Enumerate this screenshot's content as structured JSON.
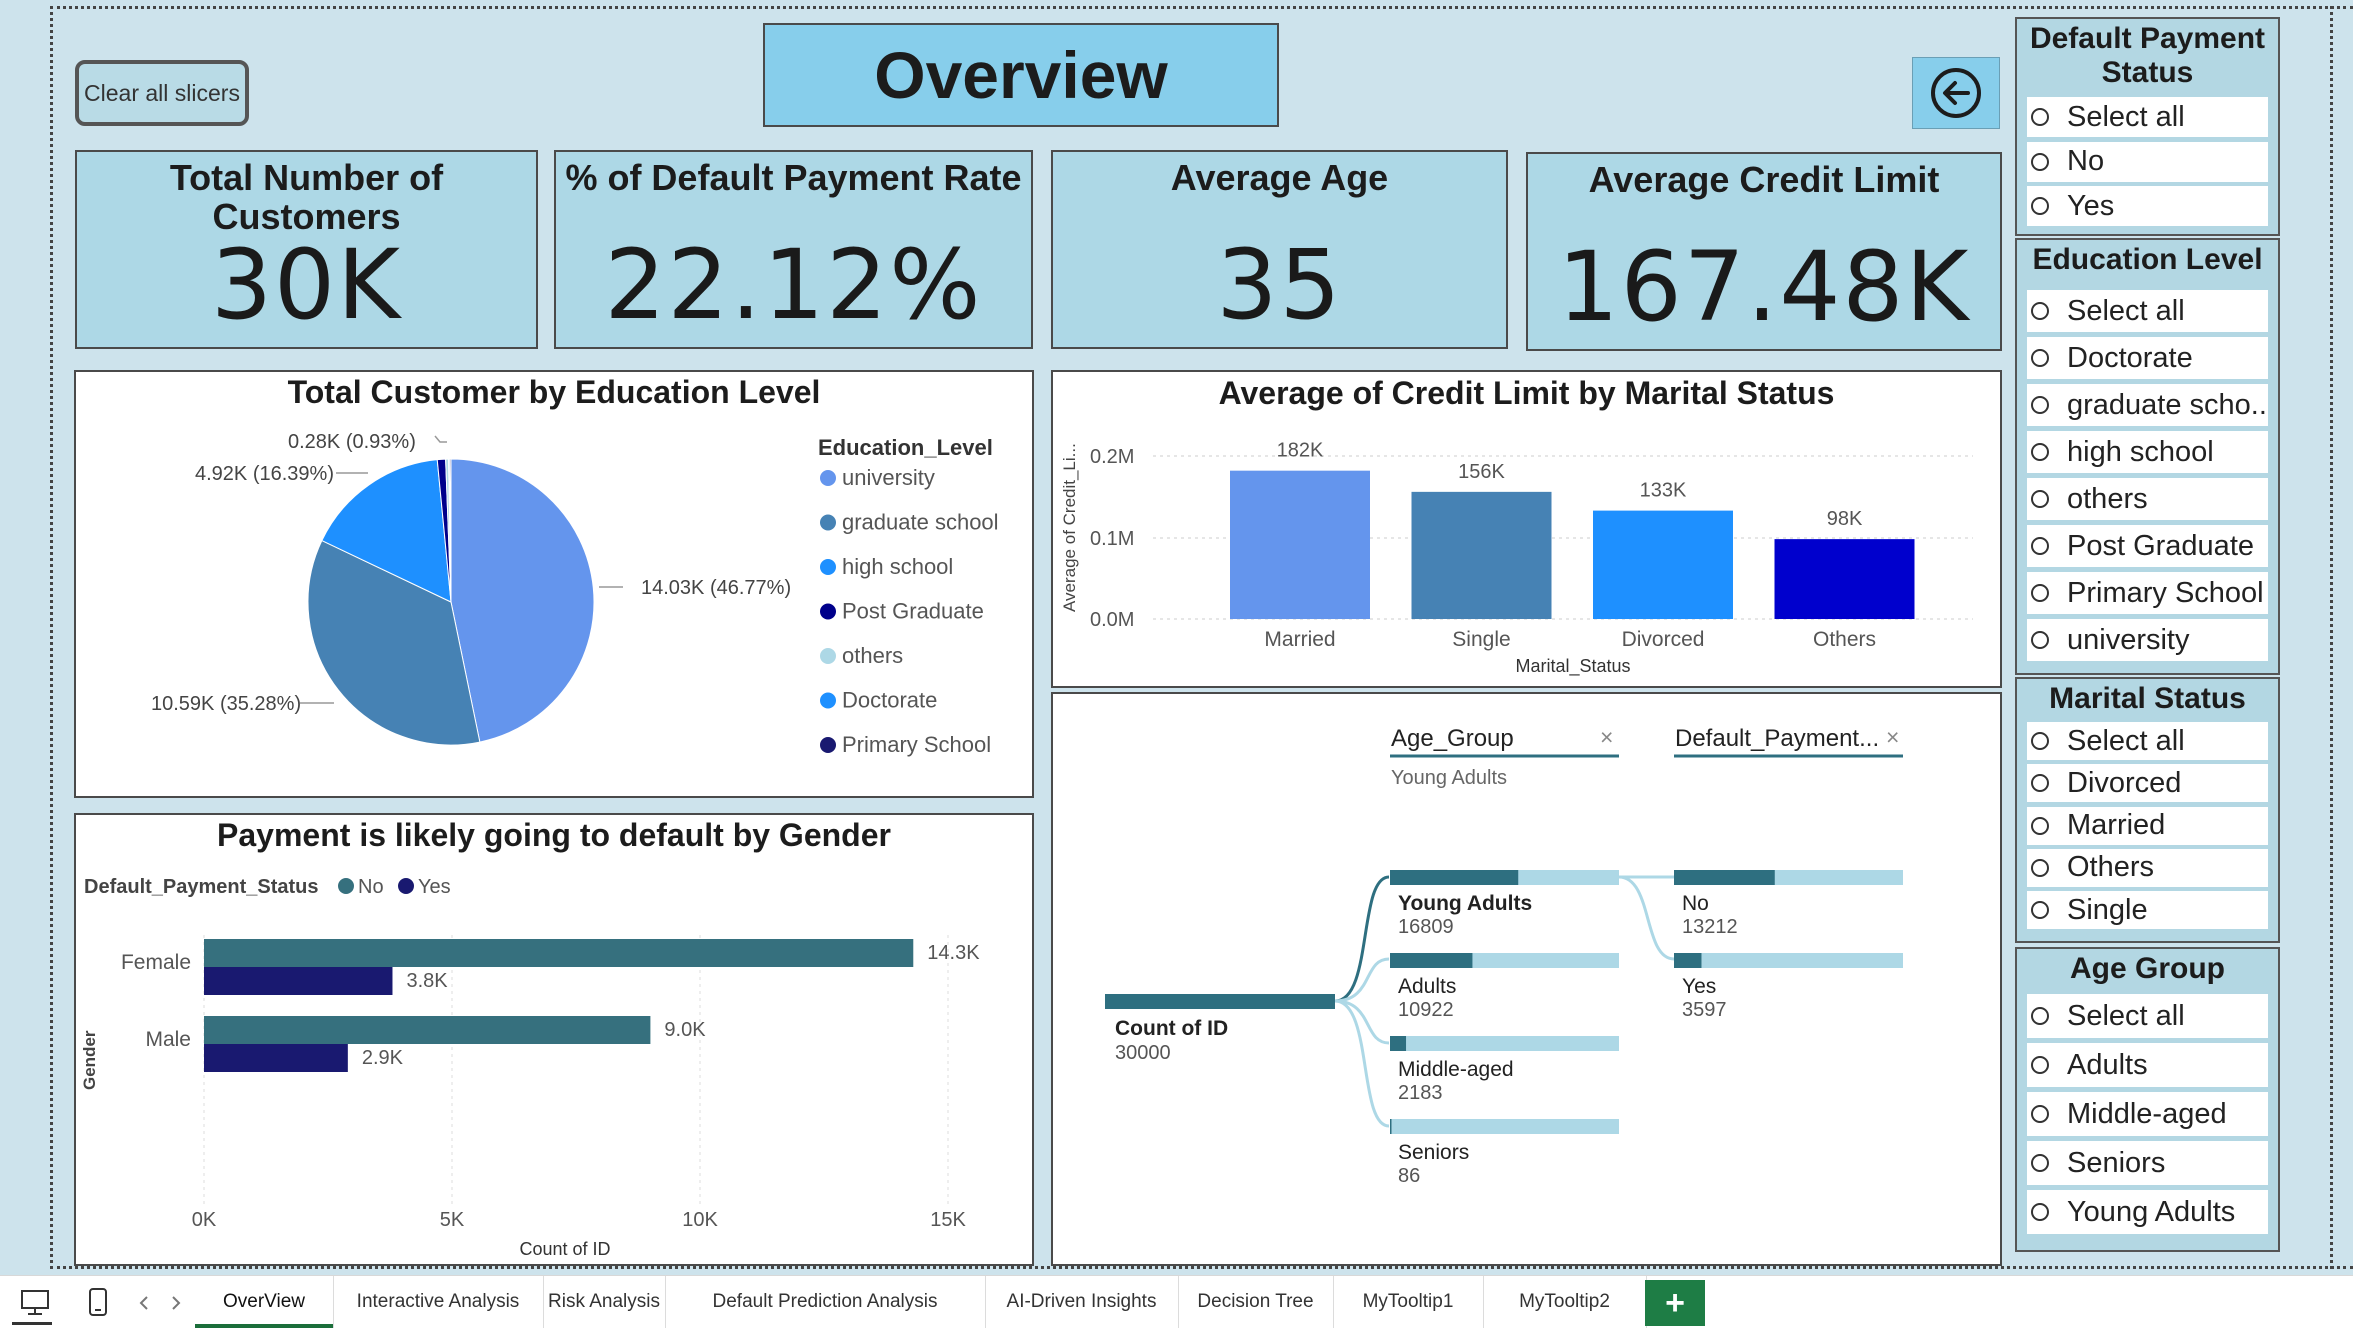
{
  "header": {
    "clear_button": "Clear all slicers",
    "title": "Overview",
    "back_icon": "back-arrow-icon"
  },
  "kpis": [
    {
      "title": "Total Number of Customers",
      "value": "30K"
    },
    {
      "title": "% of Default Payment Rate",
      "value": "22.12%"
    },
    {
      "title": "Average Age",
      "value": "35"
    },
    {
      "title": "Average Credit Limit",
      "value": "167.48K"
    }
  ],
  "pie": {
    "title": "Total Customer by Education Level",
    "legend_title": "Education_Level",
    "labels": {
      "university": "14.03K (46.77%)",
      "graduate": "10.59K (35.28%)",
      "high": "4.92K (16.39%)",
      "post": "0.28K (0.93%)"
    }
  },
  "bar": {
    "title": "Average of Credit Limit by Marital Status",
    "y_axis_title": "Average of Credit_Li...",
    "x_axis_title": "Marital_Status",
    "y_ticks": [
      "0.2M",
      "0.1M",
      "0.0M"
    ]
  },
  "gender": {
    "title": "Payment is likely going to default by Gender",
    "legend_title": "Default_Payment_Status",
    "y_axis_title": "Gender",
    "x_axis_title": "Count of ID",
    "x_ticks": [
      "0K",
      "5K",
      "10K",
      "15K"
    ]
  },
  "tree": {
    "level1_header": "Age_Group",
    "level1_filter": "Young Adults",
    "level2_header": "Default_Payment...",
    "root_label": "Count of ID",
    "root_value": "30000",
    "nodes": [
      {
        "label": "Young Adults",
        "value": "16809",
        "fill": 0.56
      },
      {
        "label": "Adults",
        "value": "10922",
        "fill": 0.36
      },
      {
        "label": "Middle-aged",
        "value": "2183",
        "fill": 0.07
      },
      {
        "label": "Seniors",
        "value": "86",
        "fill": 0.003
      }
    ],
    "children": [
      {
        "label": "No",
        "value": "13212",
        "fill": 0.44
      },
      {
        "label": "Yes",
        "value": "3597",
        "fill": 0.12
      }
    ]
  },
  "slicers": {
    "default_payment": {
      "title": "Default Payment Status",
      "options": [
        "Select all",
        "No",
        "Yes"
      ]
    },
    "education": {
      "title": "Education Level",
      "options": [
        "Select all",
        "Doctorate",
        "graduate scho...",
        "high school",
        "others",
        "Post Graduate",
        "Primary School",
        "university"
      ]
    },
    "marital": {
      "title": "Marital Status",
      "options": [
        "Select all",
        "Divorced",
        "Married",
        "Others",
        "Single"
      ]
    },
    "age": {
      "title": "Age Group",
      "options": [
        "Select all",
        "Adults",
        "Middle-aged",
        "Seniors",
        "Young Adults"
      ]
    }
  },
  "tabs": [
    "OverView",
    "Interactive Analysis",
    "Risk Analysis",
    "Default Prediction Analysis",
    "AI-Driven Insights",
    "Decision Tree",
    "MyTooltip1",
    "MyTooltip2"
  ],
  "tab_icons": [
    "desktop-view-icon",
    "mobile-view-icon",
    "prev-page-icon",
    "next-page-icon",
    "add-page-icon"
  ],
  "colors": {
    "canvas": "#cde3ec",
    "kpi": "#add8e6",
    "title": "#87ceeb",
    "tree_bar": "#2e6f80",
    "tree_track": "#add8e6",
    "add_tab": "#1e7d45"
  },
  "chart_data": [
    {
      "type": "pie",
      "title": "Total Customer by Education Level",
      "legend_title": "Education_Level",
      "categories": [
        "university",
        "graduate school",
        "high school",
        "Post Graduate",
        "others",
        "Doctorate",
        "Primary School"
      ],
      "values": [
        14030,
        10590,
        4920,
        280,
        100,
        40,
        40
      ],
      "colors": [
        "#6495ed",
        "#4682b4",
        "#1e90ff",
        "#00008b",
        "#add8e6",
        "#1e90ff",
        "#191970"
      ]
    },
    {
      "type": "bar",
      "title": "Average of Credit Limit by Marital Status",
      "xlabel": "Marital_Status",
      "ylabel": "Average of Credit_Li...",
      "categories": [
        "Married",
        "Single",
        "Divorced",
        "Others"
      ],
      "values": [
        182000,
        156000,
        133000,
        98000
      ],
      "data_labels": [
        "182K",
        "156K",
        "133K",
        "98K"
      ],
      "colors": [
        "#6495ed",
        "#4682b4",
        "#1e90ff",
        "#0000cd"
      ],
      "ylim": [
        0,
        200000
      ]
    },
    {
      "type": "bar",
      "orientation": "horizontal",
      "title": "Payment is likely going to default by Gender",
      "xlabel": "Count of ID",
      "ylabel": "Gender",
      "legend_title": "Default_Payment_Status",
      "categories": [
        "Female",
        "Male"
      ],
      "series": [
        {
          "name": "No",
          "values": [
            14300,
            9000
          ],
          "labels": [
            "14.3K",
            "9.0K"
          ],
          "color": "#36707e"
        },
        {
          "name": "Yes",
          "values": [
            3800,
            2900
          ],
          "labels": [
            "3.8K",
            "2.9K"
          ],
          "color": "#191970"
        }
      ],
      "xlim": [
        0,
        15000
      ]
    }
  ]
}
